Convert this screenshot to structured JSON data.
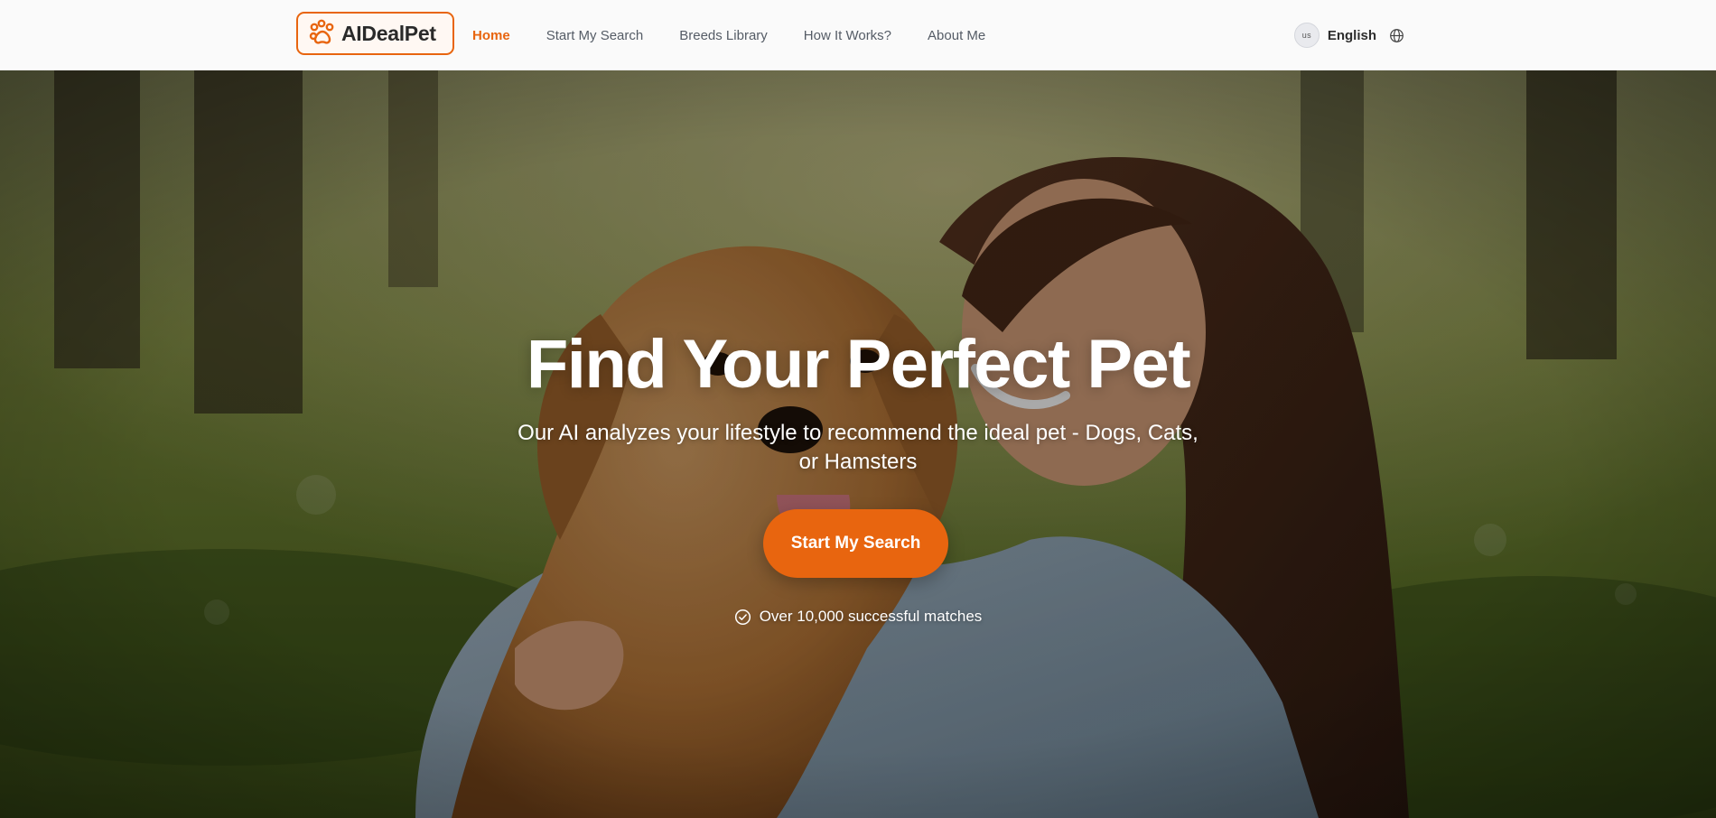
{
  "header": {
    "logo_text": "AIDealPet",
    "logo_icon": "paw-icon",
    "nav": [
      {
        "label": "Home",
        "active": true
      },
      {
        "label": "Start My Search",
        "active": false
      },
      {
        "label": "Breeds Library",
        "active": false
      },
      {
        "label": "How It Works?",
        "active": false
      },
      {
        "label": "About Me",
        "active": false
      }
    ],
    "language": {
      "flag_code": "us",
      "label": "English",
      "icon": "globe-icon"
    }
  },
  "hero": {
    "title": "Find Your Perfect Pet",
    "subtitle": "Our AI analyzes your lifestyle to recommend the ideal pet - Dogs, Cats, or Hamsters",
    "cta_label": "Start My Search",
    "matches_icon": "check-circle-icon",
    "matches_text": "Over 10,000 successful matches"
  },
  "colors": {
    "accent": "#e8650f",
    "nav_text": "#555c66",
    "header_bg": "#fafafa",
    "hero_text": "#ffffff"
  }
}
